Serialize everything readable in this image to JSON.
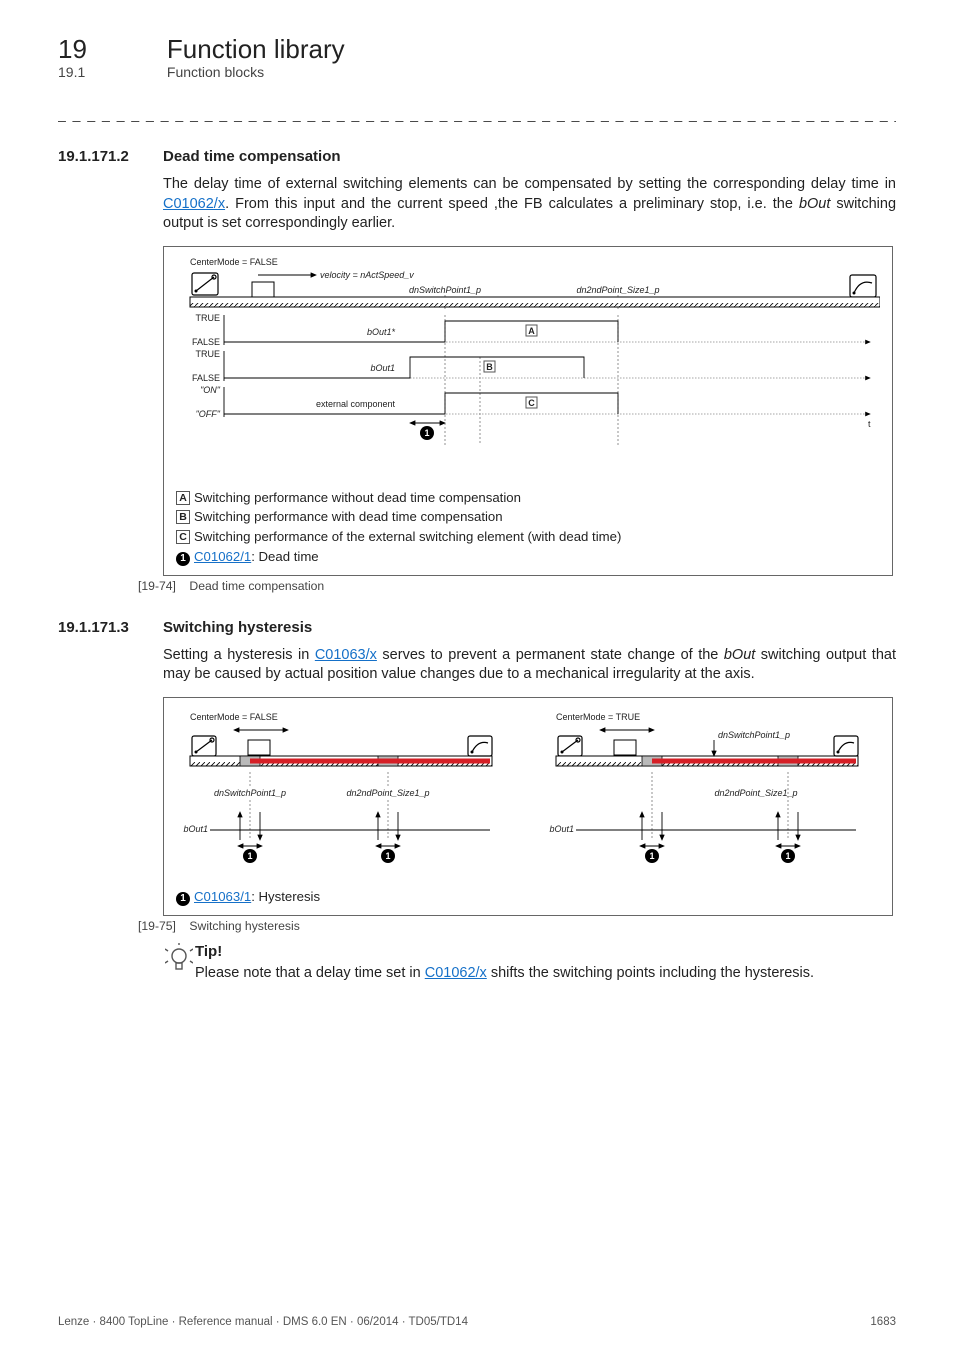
{
  "header": {
    "chapter_num": "19",
    "chapter_title": "Function library",
    "subsec_num": "19.1",
    "subsec_title": "Function blocks"
  },
  "sec1": {
    "num": "19.1.171.2",
    "title": "Dead time compensation",
    "para_a": "The delay time of external switching elements can be compensated by setting the corresponding delay time in ",
    "link": "C01062/x",
    "para_b": ". From this input and the current speed ,the FB calculates a preliminary stop, i.e. the ",
    "italic": "bOut",
    "para_c": " switching output is set correspondingly earlier."
  },
  "fig1": {
    "centermode": "CenterMode = FALSE",
    "velocity_lbl": "velocity = nActSpeed_v",
    "sw1": "dnSwitchPoint1_p",
    "sw2": "dn2ndPoint_Size1_p",
    "true": "TRUE",
    "false": "FALSE",
    "on": "\"ON\"",
    "off": "\"OFF\"",
    "y1": "bOut1*",
    "y2": "bOut1",
    "y3": "external component",
    "A": "A",
    "B": "B",
    "C": "C",
    "t": "t",
    "leg_a": "Switching performance without dead time compensation",
    "leg_b": "Switching performance with dead time compensation",
    "leg_c": "Switching performance of the external switching element (with dead time)",
    "leg_d_link": "C01062/1",
    "leg_d_txt": ": Dead time",
    "cap_num": "[19-74]",
    "cap_txt": "Dead time compensation"
  },
  "sec2": {
    "num": "19.1.171.3",
    "title": "Switching hysteresis",
    "para_a": "Setting a hysteresis in ",
    "link": "C01063/x",
    "para_b": " serves to prevent a permanent state change of the ",
    "italic": "bOut",
    "para_c": " switching output that may be caused by actual position value changes due to a mechanical irregularity at the axis."
  },
  "fig2": {
    "cm_false": "CenterMode = FALSE",
    "cm_true": "CenterMode = TRUE",
    "sw1": "dnSwitchPoint1_p",
    "sw2": "dn2ndPoint_Size1_p",
    "bOut1": "bOut1",
    "leg_link": "C01063/1",
    "leg_txt": ": Hysteresis",
    "cap_num": "[19-75]",
    "cap_txt": "Switching hysteresis"
  },
  "tip": {
    "title": "Tip!",
    "body_a": "Please note that a delay time set in ",
    "link": "C01062/x",
    "body_b": " shifts the switching points including the hysteresis."
  },
  "footer": {
    "left": "Lenze · 8400 TopLine · Reference manual · DMS 6.0 EN · 06/2014 · TD05/TD14",
    "right": "1683"
  }
}
